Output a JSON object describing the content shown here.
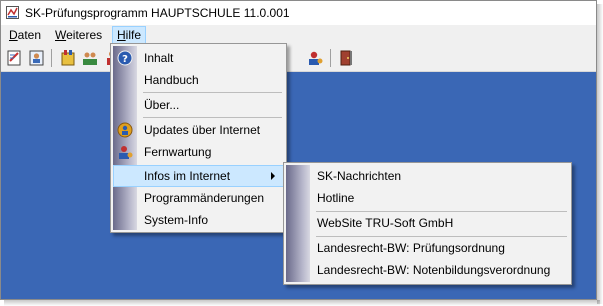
{
  "window": {
    "title": "SK-Prüfungsprogramm HAUPTSCHULE 11.0.001"
  },
  "menubar": {
    "items": [
      {
        "label": "Daten",
        "mnemonic": "D"
      },
      {
        "label": "Weiteres",
        "mnemonic": "W"
      },
      {
        "label": "Hilfe",
        "mnemonic": "H"
      }
    ]
  },
  "toolbar": {
    "icons": [
      "edit-sheet-icon",
      "student-list-icon",
      "certificate-icon",
      "class-icon",
      "group-icon",
      "remote-support-icon",
      "exit-door-icon"
    ]
  },
  "hilfe_menu": {
    "items": [
      {
        "label": "Inhalt",
        "icon": "help-icon"
      },
      {
        "label": "Handbuch"
      },
      {
        "label": "Über..."
      },
      {
        "label": "Updates über Internet",
        "icon": "update-icon"
      },
      {
        "label": "Fernwartung",
        "icon": "remote-support-icon"
      },
      {
        "label": "Infos im Internet",
        "has_submenu": true,
        "highlighted": true
      },
      {
        "label": "Programmänderungen"
      },
      {
        "label": "System-Info"
      }
    ]
  },
  "infos_submenu": {
    "items": [
      {
        "label": "SK-Nachrichten"
      },
      {
        "label": "Hotline"
      },
      {
        "label": "WebSite TRU-Soft GmbH"
      },
      {
        "label": "Landesrecht-BW: Prüfungsordnung"
      },
      {
        "label": "Landesrecht-BW: Notenbildungsverordnung"
      }
    ]
  },
  "colors": {
    "client_background": "#3a67b5",
    "menu_highlight": "#cce8ff",
    "menu_highlight_border": "#99d1ff"
  }
}
